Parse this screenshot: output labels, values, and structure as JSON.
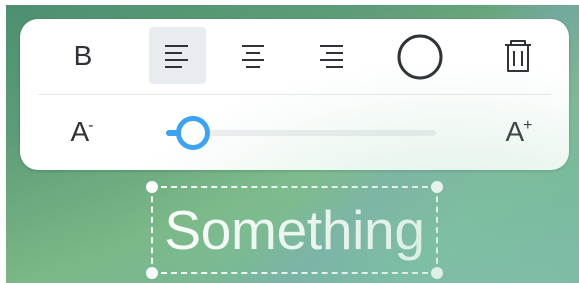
{
  "toolbar": {
    "bold_label": "B",
    "text_smaller_glyph": "A",
    "text_smaller_mark": "-",
    "text_larger_glyph": "A",
    "text_larger_mark": "+",
    "align": {
      "selected": "left",
      "options": [
        "left",
        "center",
        "right"
      ]
    },
    "color_swatch_icon": "circle-outline-icon",
    "delete_icon": "trash-icon",
    "font_size_slider": {
      "value": 0.1
    },
    "colors": {
      "panel": "#ffffff",
      "selected_background": "#e8ebef",
      "icon": "#2f3337",
      "accent": "#3ea2f2"
    }
  },
  "canvas": {
    "text_element": {
      "text": "Something",
      "color": "#ffffff"
    }
  }
}
